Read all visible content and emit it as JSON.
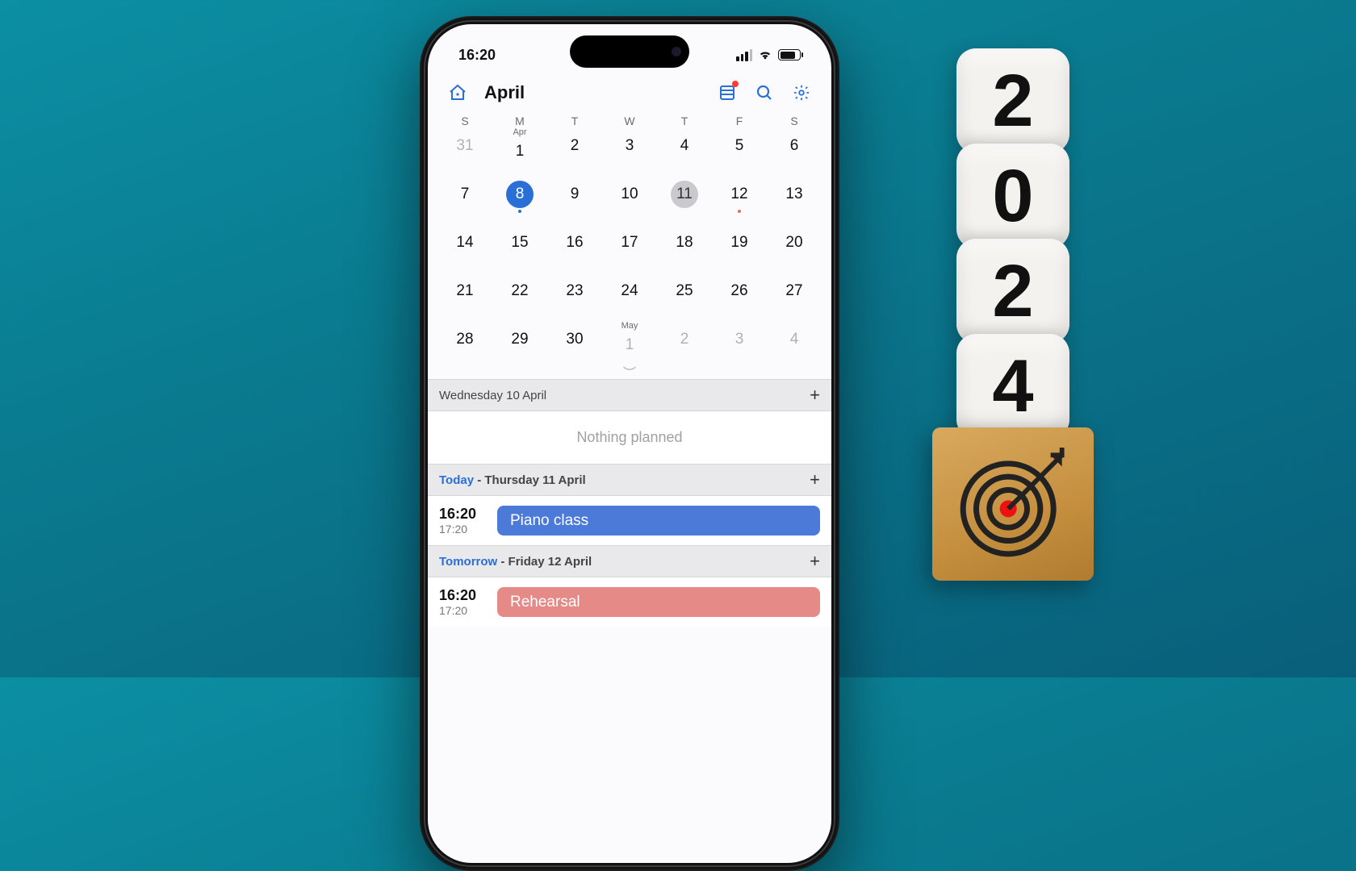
{
  "status_bar": {
    "time": "16:20"
  },
  "header": {
    "month_title": "April"
  },
  "dow": [
    "S",
    "M",
    "T",
    "W",
    "T",
    "F",
    "S"
  ],
  "month_tags": {
    "apr": "Apr",
    "may": "May"
  },
  "grid_weeks": [
    [
      {
        "n": "31",
        "muted": true
      },
      {
        "n": "1",
        "tag": "apr"
      },
      {
        "n": "2"
      },
      {
        "n": "3"
      },
      {
        "n": "4"
      },
      {
        "n": "5"
      },
      {
        "n": "6"
      }
    ],
    [
      {
        "n": "7"
      },
      {
        "n": "8",
        "selected": true,
        "dot": "blue"
      },
      {
        "n": "9"
      },
      {
        "n": "10"
      },
      {
        "n": "11",
        "today": true
      },
      {
        "n": "12",
        "dot": "red"
      },
      {
        "n": "13"
      }
    ],
    [
      {
        "n": "14"
      },
      {
        "n": "15"
      },
      {
        "n": "16"
      },
      {
        "n": "17"
      },
      {
        "n": "18"
      },
      {
        "n": "19"
      },
      {
        "n": "20"
      }
    ],
    [
      {
        "n": "21"
      },
      {
        "n": "22"
      },
      {
        "n": "23"
      },
      {
        "n": "24"
      },
      {
        "n": "25"
      },
      {
        "n": "26"
      },
      {
        "n": "27"
      }
    ],
    [
      {
        "n": "28"
      },
      {
        "n": "29"
      },
      {
        "n": "30"
      },
      {
        "n": "1",
        "tag": "may",
        "muted": true
      },
      {
        "n": "2",
        "muted": true
      },
      {
        "n": "3",
        "muted": true
      },
      {
        "n": "4",
        "muted": true
      }
    ]
  ],
  "sections": [
    {
      "prefix": "",
      "date": "Wednesday 10 April",
      "empty": "Nothing planned",
      "events": []
    },
    {
      "prefix": "Today",
      "date": " - Thursday 11 April",
      "events": [
        {
          "start": "16:20",
          "end": "17:20",
          "title": "Piano class",
          "color": "#4b7ad9"
        }
      ]
    },
    {
      "prefix": "Tomorrow",
      "date": " - Friday 12 April",
      "events": [
        {
          "start": "16:20",
          "end": "17:20",
          "title": "Rehearsal",
          "color": "#e58a86"
        }
      ]
    }
  ],
  "decor": {
    "cubes": [
      "2",
      "0",
      "2",
      "4"
    ]
  }
}
